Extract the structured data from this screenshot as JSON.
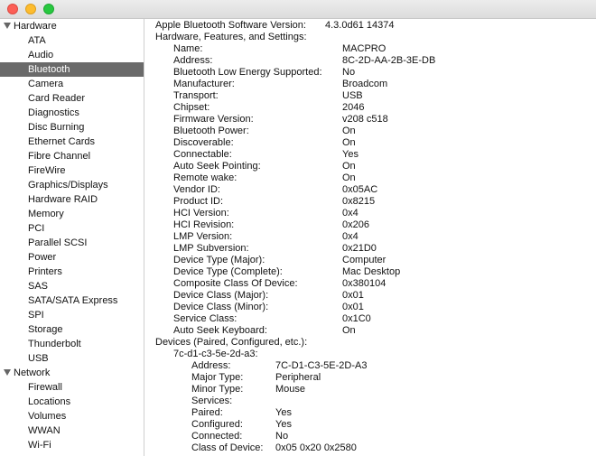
{
  "sidebar": {
    "hardware_label": "Hardware",
    "hardware_items": [
      "ATA",
      "Audio",
      "Bluetooth",
      "Camera",
      "Card Reader",
      "Diagnostics",
      "Disc Burning",
      "Ethernet Cards",
      "Fibre Channel",
      "FireWire",
      "Graphics/Displays",
      "Hardware RAID",
      "Memory",
      "PCI",
      "Parallel SCSI",
      "Power",
      "Printers",
      "SAS",
      "SATA/SATA Express",
      "SPI",
      "Storage",
      "Thunderbolt",
      "USB"
    ],
    "selected": "Bluetooth",
    "network_label": "Network",
    "network_items": [
      "Firewall",
      "Locations",
      "Volumes",
      "WWAN",
      "Wi-Fi"
    ]
  },
  "content": {
    "software_version_label": "Apple Bluetooth Software Version:",
    "software_version_value": "4.3.0d61 14374",
    "hw_section_label": "Hardware, Features, and Settings:",
    "hw_fields": [
      {
        "label": "Name:",
        "value": "MACPRO"
      },
      {
        "label": "Address:",
        "value": "8C-2D-AA-2B-3E-DB"
      },
      {
        "label": "Bluetooth Low Energy Supported:",
        "value": "No"
      },
      {
        "label": "Manufacturer:",
        "value": "Broadcom"
      },
      {
        "label": "Transport:",
        "value": "USB"
      },
      {
        "label": "Chipset:",
        "value": "2046"
      },
      {
        "label": "Firmware Version:",
        "value": "v208 c518"
      },
      {
        "label": "Bluetooth Power:",
        "value": "On"
      },
      {
        "label": "Discoverable:",
        "value": "On"
      },
      {
        "label": "Connectable:",
        "value": "Yes"
      },
      {
        "label": "Auto Seek Pointing:",
        "value": "On"
      },
      {
        "label": "Remote wake:",
        "value": "On"
      },
      {
        "label": "Vendor ID:",
        "value": "0x05AC"
      },
      {
        "label": "Product ID:",
        "value": "0x8215"
      },
      {
        "label": "HCI Version:",
        "value": "0x4"
      },
      {
        "label": "HCI Revision:",
        "value": "0x206"
      },
      {
        "label": "LMP Version:",
        "value": "0x4"
      },
      {
        "label": "LMP Subversion:",
        "value": "0x21D0"
      },
      {
        "label": "Device Type (Major):",
        "value": "Computer"
      },
      {
        "label": "Device Type (Complete):",
        "value": "Mac Desktop"
      },
      {
        "label": "Composite Class Of Device:",
        "value": "0x380104"
      },
      {
        "label": "Device Class (Major):",
        "value": "0x01"
      },
      {
        "label": "Device Class (Minor):",
        "value": "0x01"
      },
      {
        "label": "Service Class:",
        "value": "0x1C0"
      },
      {
        "label": "Auto Seek Keyboard:",
        "value": "On"
      }
    ],
    "devices_label": "Devices (Paired, Configured, etc.):",
    "device_name": "7c-d1-c3-5e-2d-a3:",
    "device_fields": [
      {
        "label": "Address:",
        "value": "7C-D1-C3-5E-2D-A3"
      },
      {
        "label": "Major Type:",
        "value": "Peripheral"
      },
      {
        "label": "Minor Type:",
        "value": "Mouse"
      },
      {
        "label": "Services:",
        "value": ""
      },
      {
        "label": "Paired:",
        "value": "Yes"
      },
      {
        "label": "Configured:",
        "value": "Yes"
      },
      {
        "label": "Connected:",
        "value": "No"
      },
      {
        "label": "Class of Device:",
        "value": "0x05 0x20 0x2580"
      }
    ]
  }
}
